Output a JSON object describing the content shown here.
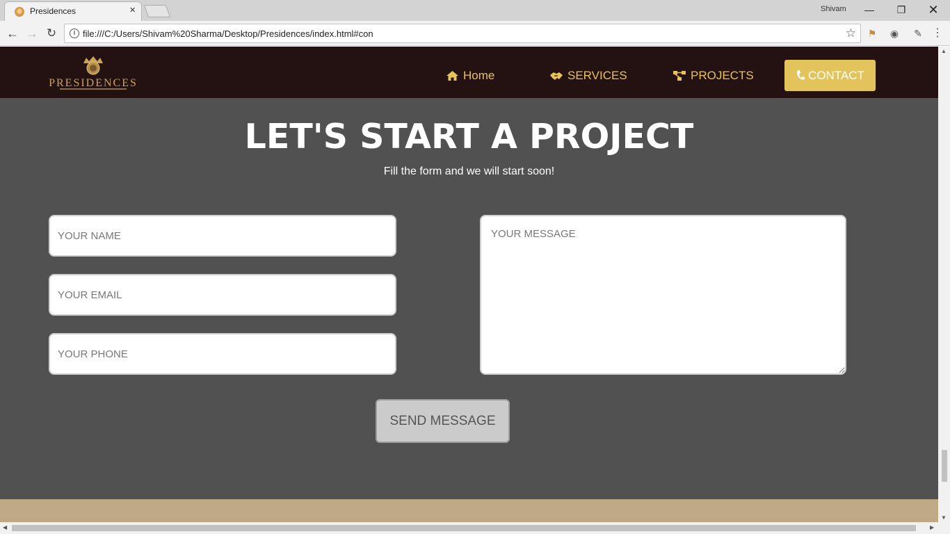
{
  "browser": {
    "tab_title": "Presidences",
    "tab_close": "×",
    "profile_name": "Shivam",
    "url": "file:///C:/Users/Shivam%20Sharma/Desktop/Presidences/index.html#con",
    "icons": {
      "back": "arrow-left-icon",
      "forward": "arrow-right-icon",
      "reload": "reload-icon",
      "info": "info-icon",
      "bookmark": "star-icon",
      "menu": "kebab-menu-icon"
    }
  },
  "site": {
    "logo_text": "PRESIDENCES",
    "nav": {
      "home": "Home",
      "services": "SERVICES",
      "projects": "PROJECTS",
      "contact": "CONTACT"
    },
    "colors": {
      "header_bg": "#241111",
      "accent": "#e2c35c",
      "section_bg": "#505150",
      "footer_band": "#c0a987"
    }
  },
  "contact": {
    "title": "LET'S START A PROJECT",
    "subtitle": "Fill the form and we will start soon!",
    "name_placeholder": "YOUR NAME",
    "email_placeholder": "YOUR EMAIL",
    "phone_placeholder": "YOUR PHONE",
    "message_placeholder": "YOUR MESSAGE",
    "send_label": "SEND MESSAGE"
  }
}
